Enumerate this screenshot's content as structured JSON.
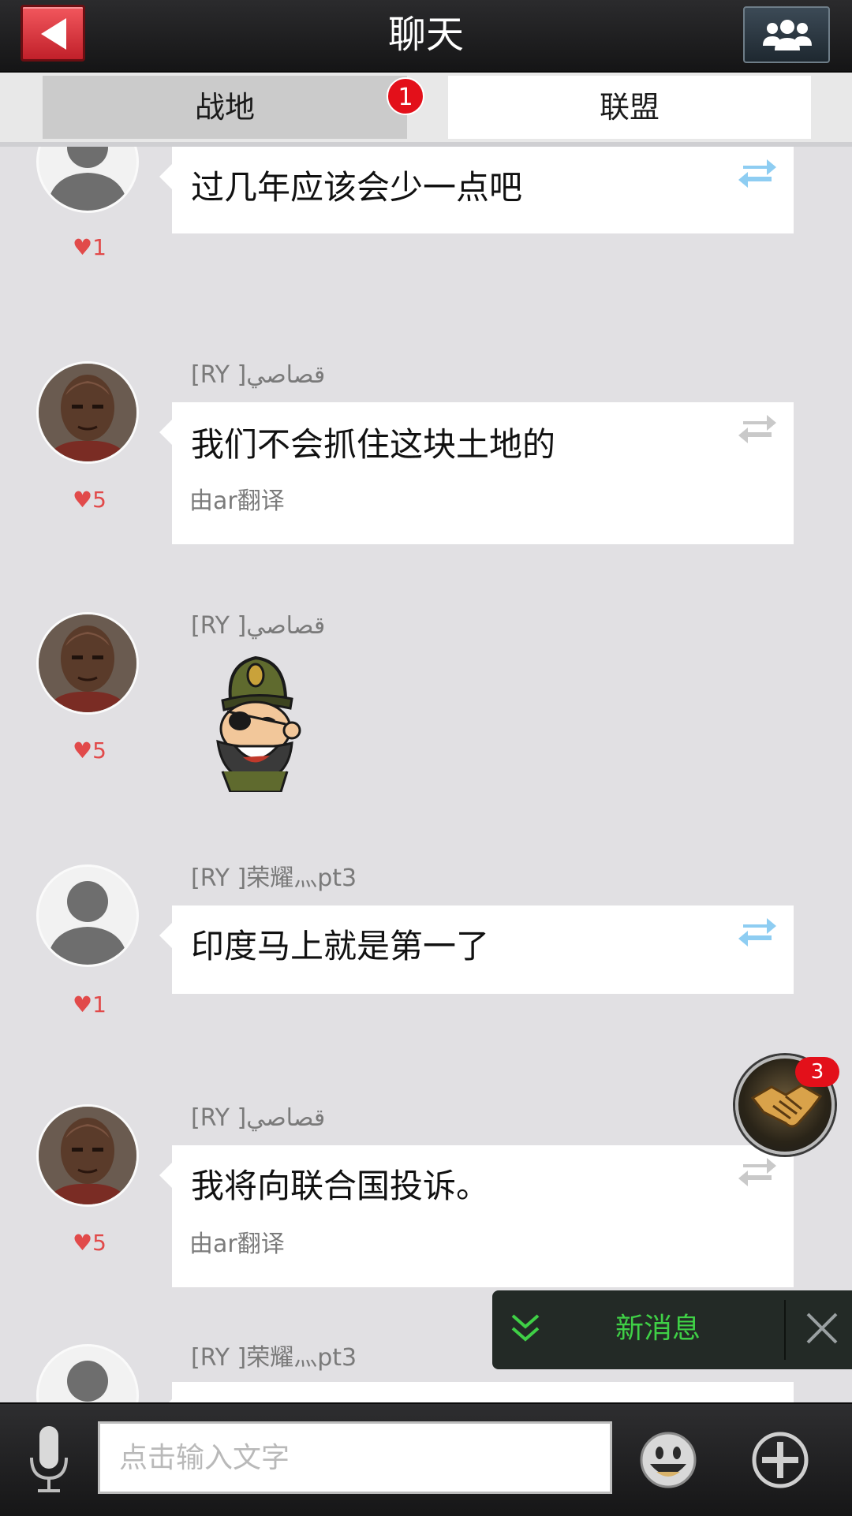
{
  "header": {
    "title": "聊天"
  },
  "tabs": [
    {
      "label": "战地",
      "badge": "1",
      "active": false
    },
    {
      "label": "联盟",
      "active": true
    }
  ],
  "messages": [
    {
      "sender": "",
      "text": "过几年应该会少一点吧",
      "likes": "1",
      "avatar": "default",
      "translated": "",
      "translate_icon": "translate-blue"
    },
    {
      "sender": "[RY ]قصاصي",
      "text": "我们不会抓住这块土地的",
      "likes": "5",
      "avatar": "soldier",
      "translated": "由ar翻译",
      "translate_icon": "translate-gray"
    },
    {
      "sender": "[RY ]قصاصي",
      "text": "",
      "likes": "5",
      "avatar": "soldier",
      "sticker": "pirate-officer-sticker"
    },
    {
      "sender": "[RY ]荣耀灬pt3",
      "text": "印度马上就是第一了",
      "likes": "1",
      "avatar": "default",
      "translated": "",
      "translate_icon": "translate-blue"
    },
    {
      "sender": "[RY ]قصاصي",
      "text": "我将向联合国投诉。",
      "likes": "5",
      "avatar": "soldier",
      "translated": "由ar翻译",
      "translate_icon": "translate-gray"
    },
    {
      "sender": "[RY ]荣耀灬pt3",
      "text": "",
      "likes": "",
      "avatar": "default"
    }
  ],
  "alliance_button": {
    "badge": "3"
  },
  "toast": {
    "label": "新消息"
  },
  "input": {
    "placeholder": "点击输入文字"
  },
  "colors": {
    "accent_red": "#e3101a",
    "like_red": "#e14a4a",
    "toast_green": "#3fd046",
    "translate_blue": "#8ecdf2"
  }
}
